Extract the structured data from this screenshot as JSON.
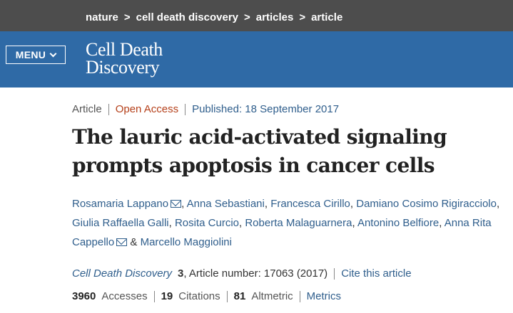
{
  "breadcrumb": {
    "items": [
      "nature",
      "cell death discovery",
      "articles",
      "article"
    ],
    "separator": ">"
  },
  "header": {
    "menu_label": "MENU",
    "logo_line1": "Cell Death",
    "logo_line2": "Discovery",
    "brand_color": "#2f6aa6"
  },
  "article": {
    "type": "Article",
    "access": "Open Access",
    "published": "Published: 18 September 2017",
    "title": "The lauric acid-activated signaling prompts apoptosis in cancer cells",
    "authors": [
      "Rosamaria Lappano",
      "Anna Sebastiani",
      "Francesca Cirillo",
      "Damiano Cosimo Rigiracciolo",
      "Giulia Raffaella Galli",
      "Rosita Curcio",
      "Roberta Malaguarnera",
      "Antonino Belfiore",
      "Anna Rita Cappello",
      "Marcello Maggiolini"
    ],
    "authors_conjunction": "&",
    "citation": {
      "journal": "Cell Death Discovery",
      "volume": "3",
      "article_number": ", Article number: 17063 (2017)",
      "cite_link": "Cite this article"
    },
    "metrics": {
      "accesses_count": "3960",
      "accesses_label": "Accesses",
      "citations_count": "19",
      "citations_label": "Citations",
      "altmetric_count": "81",
      "altmetric_label": "Altmetric",
      "metrics_link": "Metrics"
    }
  }
}
